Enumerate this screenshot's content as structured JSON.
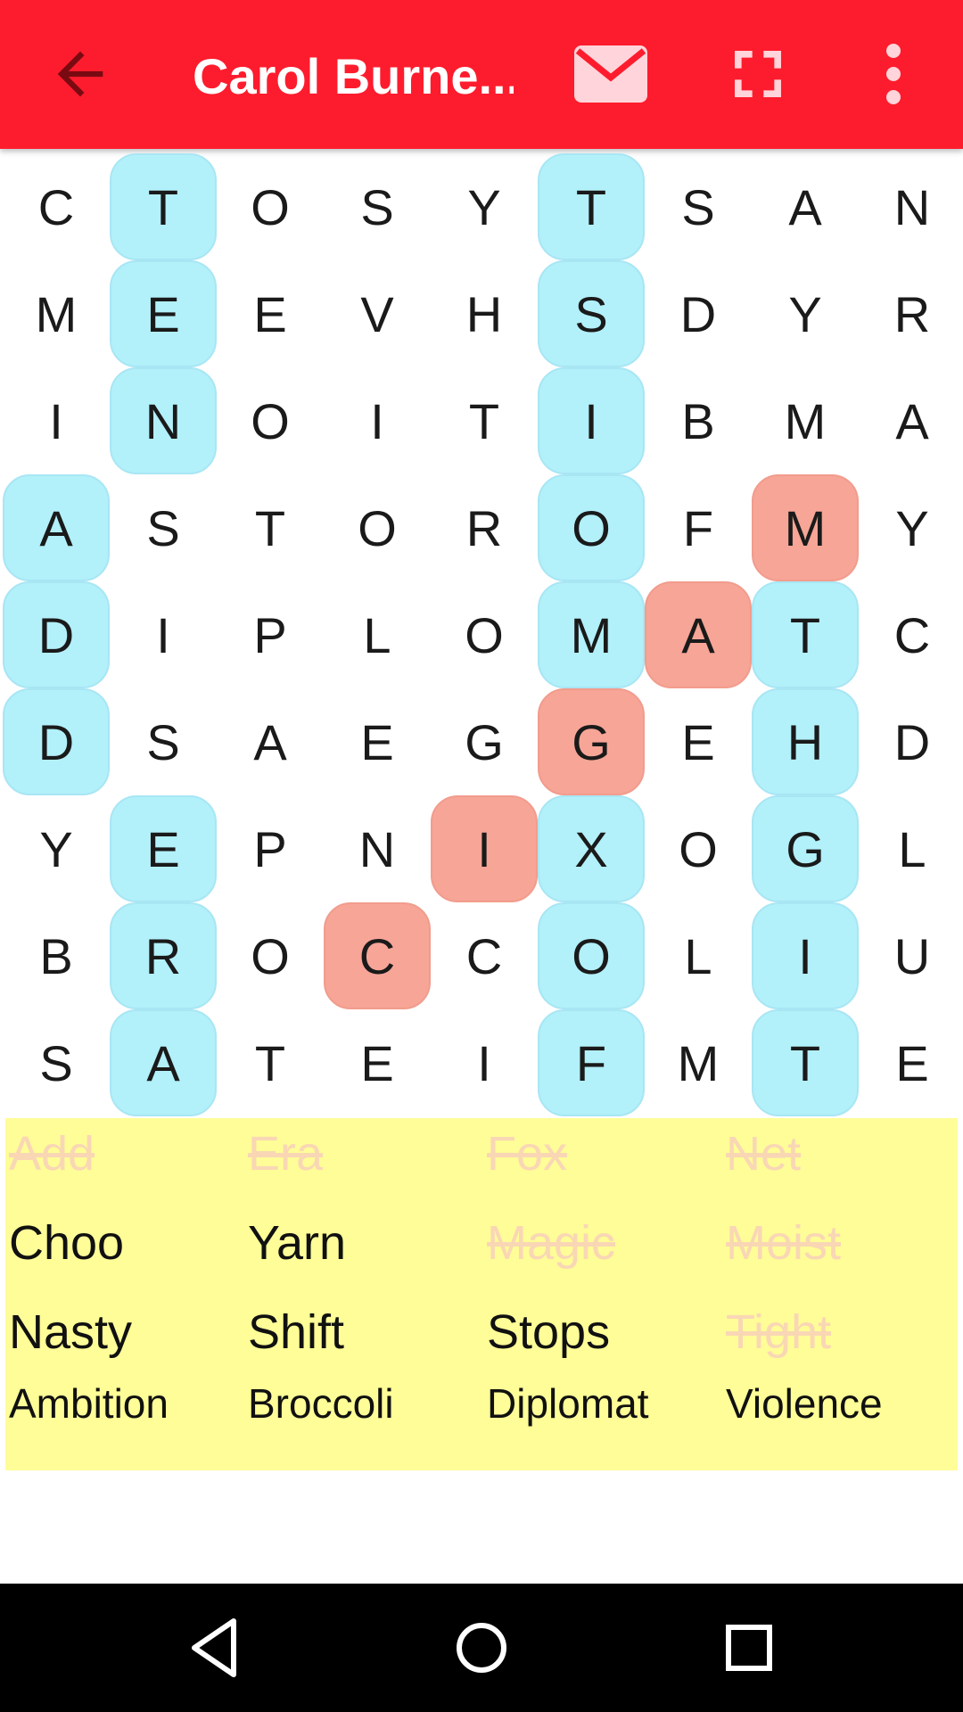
{
  "app_bar": {
    "title": "Carol Burne...",
    "background": "#fd1c2d",
    "icons": [
      "back-arrow-icon",
      "mail-icon",
      "fullscreen-icon",
      "more-vert-icon"
    ]
  },
  "grid": {
    "rows": [
      [
        "C",
        "T",
        "O",
        "S",
        "Y",
        "T",
        "S",
        "A",
        "N"
      ],
      [
        "M",
        "E",
        "E",
        "V",
        "H",
        "S",
        "D",
        "Y",
        "R"
      ],
      [
        "I",
        "N",
        "O",
        "I",
        "T",
        "I",
        "B",
        "M",
        "A"
      ],
      [
        "A",
        "S",
        "T",
        "O",
        "R",
        "O",
        "F",
        "M",
        "Y"
      ],
      [
        "D",
        "I",
        "P",
        "L",
        "O",
        "M",
        "A",
        "T",
        "C"
      ],
      [
        "D",
        "S",
        "A",
        "E",
        "G",
        "G",
        "E",
        "H",
        "D"
      ],
      [
        "Y",
        "E",
        "P",
        "N",
        "I",
        "X",
        "O",
        "G",
        "L"
      ],
      [
        "B",
        "R",
        "O",
        "C",
        "C",
        "O",
        "L",
        "I",
        "U"
      ],
      [
        "S",
        "A",
        "T",
        "E",
        "I",
        "F",
        "M",
        "T",
        "E"
      ]
    ],
    "highlights": [
      [
        "",
        "blue",
        "",
        "",
        "",
        "blue",
        "",
        "",
        ""
      ],
      [
        "",
        "blue",
        "",
        "",
        "",
        "blue",
        "",
        "",
        ""
      ],
      [
        "",
        "blue",
        "",
        "",
        "",
        "blue",
        "",
        "",
        ""
      ],
      [
        "blue",
        "",
        "",
        "",
        "",
        "blue",
        "",
        "red",
        ""
      ],
      [
        "blue",
        "",
        "",
        "",
        "",
        "blue",
        "red",
        "blue",
        ""
      ],
      [
        "blue",
        "",
        "",
        "",
        "",
        "red",
        "",
        "blue",
        ""
      ],
      [
        "",
        "blue",
        "",
        "",
        "red",
        "blue",
        "",
        "blue",
        ""
      ],
      [
        "",
        "blue",
        "",
        "red",
        "",
        "blue",
        "",
        "blue",
        ""
      ],
      [
        "",
        "blue",
        "",
        "",
        "",
        "blue",
        "",
        "blue",
        ""
      ]
    ],
    "colors": {
      "found": "#b2f0fa",
      "selecting": "#f6a597"
    }
  },
  "word_list": {
    "background": "#fffd97",
    "rows": [
      [
        {
          "text": "Add",
          "found": true
        },
        {
          "text": "Era",
          "found": true
        },
        {
          "text": "Fox",
          "found": true
        },
        {
          "text": "Net",
          "found": true
        }
      ],
      [
        {
          "text": "Choo",
          "found": false
        },
        {
          "text": "Yarn",
          "found": false
        },
        {
          "text": "Magic",
          "found": true
        },
        {
          "text": "Moist",
          "found": true
        }
      ],
      [
        {
          "text": "Nasty",
          "found": false
        },
        {
          "text": "Shift",
          "found": false
        },
        {
          "text": "Stops",
          "found": false
        },
        {
          "text": "Tight",
          "found": true
        }
      ],
      [
        {
          "text": "Ambition",
          "found": false
        },
        {
          "text": "Broccoli",
          "found": false
        },
        {
          "text": "Diplomat",
          "found": false
        },
        {
          "text": "Violence",
          "found": false
        }
      ]
    ]
  },
  "nav_bar": {
    "icons": [
      "back-triangle-icon",
      "home-circle-icon",
      "recents-square-icon"
    ]
  }
}
